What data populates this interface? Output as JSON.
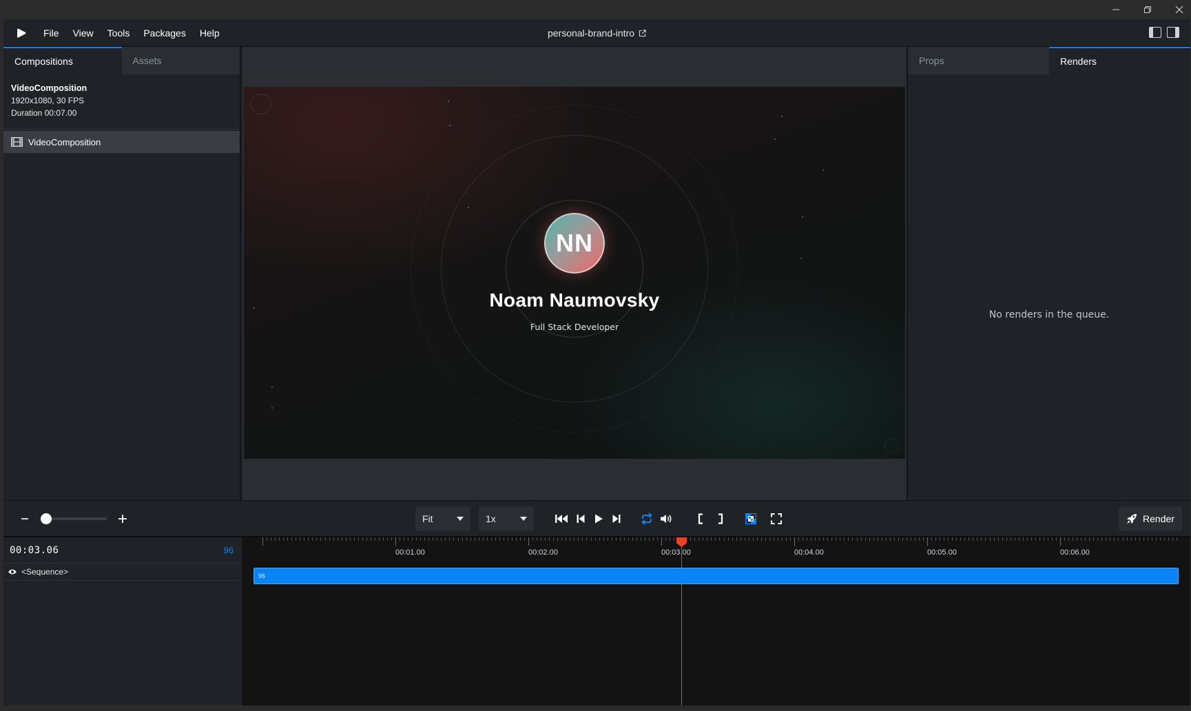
{
  "window": {
    "controls": [
      "minimize",
      "restore",
      "close"
    ]
  },
  "menubar": {
    "items": [
      "File",
      "View",
      "Tools",
      "Packages",
      "Help"
    ],
    "project_title": "personal-brand-intro"
  },
  "left_panel": {
    "tabs": [
      "Compositions",
      "Assets"
    ],
    "active_tab": "Compositions",
    "composition_info": {
      "name": "VideoComposition",
      "resolution_fps": "1920x1080, 30 FPS",
      "duration": "Duration 00:07.00"
    },
    "compositions": [
      "VideoComposition"
    ]
  },
  "preview": {
    "initials": "NN",
    "name": "Noam Naumovsky",
    "role": "Full Stack Developer"
  },
  "right_panel": {
    "tabs": [
      "Props",
      "Renders"
    ],
    "active_tab": "Renders",
    "empty_message": "No renders in the queue."
  },
  "controls": {
    "size_select": "Fit",
    "speed_select": "1x",
    "render_label": "Render",
    "zoom_level": 0.0,
    "accent_color": "#0b84f3"
  },
  "timeline": {
    "timecode": "00:03.06",
    "frame": "96",
    "track_label": "<Sequence>",
    "sequence_frame_label": "96",
    "tick_labels": [
      "00:01.00",
      "00:02.00",
      "00:03.00",
      "00:04.00",
      "00:05.00",
      "00:06.00"
    ],
    "playhead_color": "#e8412a"
  }
}
